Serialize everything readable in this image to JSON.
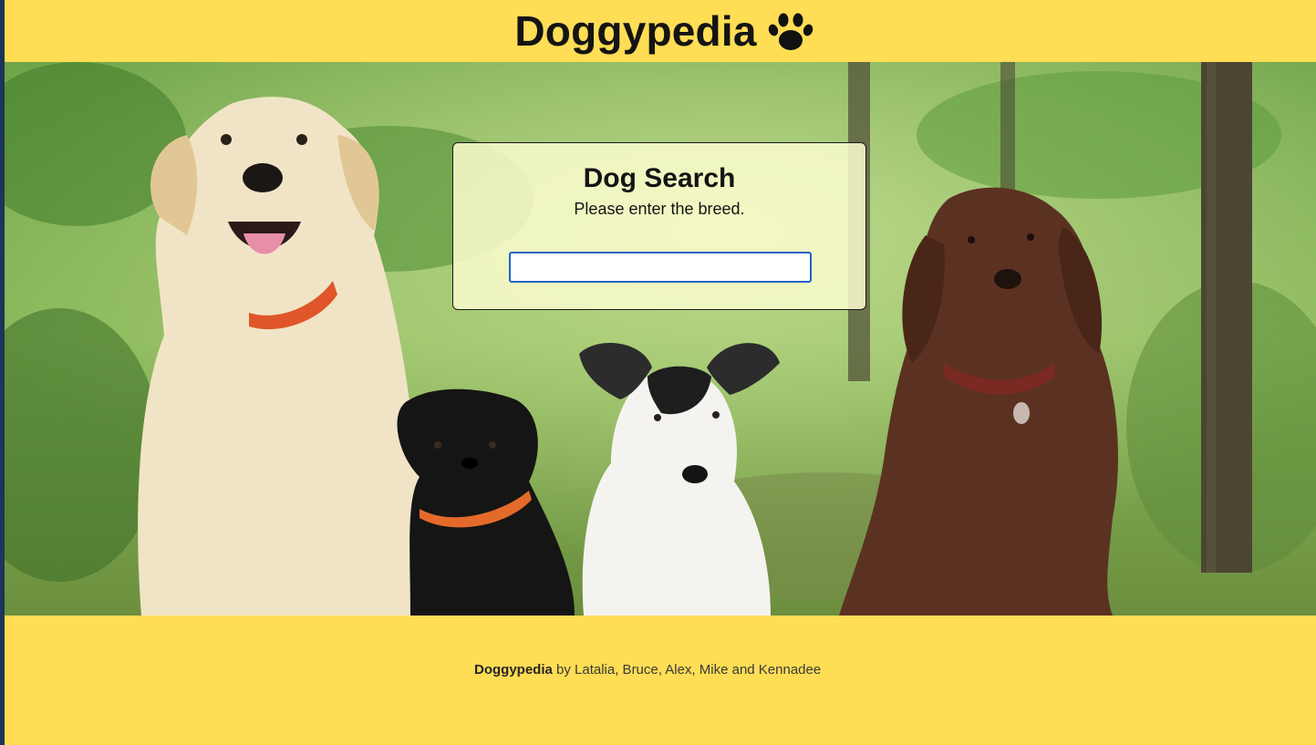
{
  "header": {
    "title": "Doggypedia",
    "icon": "paw-icon"
  },
  "hero": {
    "image": "four-dogs-in-forest-photo"
  },
  "search": {
    "title": "Dog Search",
    "subtitle": "Please enter the breed.",
    "input_value": "",
    "input_placeholder": ""
  },
  "footer": {
    "brand": "Doggypedia",
    "credits": " by Latalia, Bruce, Alex, Mike and Kennadee"
  },
  "colors": {
    "header_bg": "#ffdd55",
    "footer_bg": "#ffdd55",
    "input_border": "#1f63c7",
    "card_bg": "#fafccd"
  }
}
